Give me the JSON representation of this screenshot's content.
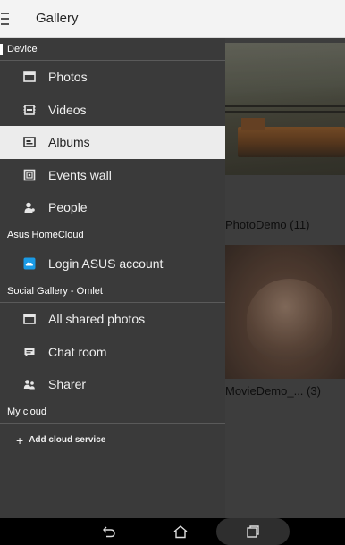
{
  "appbar": {
    "menu_icon": "hamburger-icon",
    "title": "Gallery"
  },
  "drawer": {
    "sections": [
      {
        "header": "Device",
        "items": [
          {
            "label": "Photos",
            "icon": "photos-icon",
            "selected": false
          },
          {
            "label": "Videos",
            "icon": "videos-icon",
            "selected": false
          },
          {
            "label": "Albums",
            "icon": "albums-icon",
            "selected": true
          },
          {
            "label": "Events wall",
            "icon": "events-wall-icon",
            "selected": false
          },
          {
            "label": "People",
            "icon": "people-icon",
            "selected": false
          }
        ]
      },
      {
        "header": "Asus HomeCloud",
        "items": [
          {
            "label": "Login ASUS account",
            "icon": "asus-cloud-icon",
            "selected": false
          }
        ]
      },
      {
        "header": "Social Gallery - Omlet",
        "items": [
          {
            "label": "All shared photos",
            "icon": "shared-photos-icon",
            "selected": false
          },
          {
            "label": "Chat room",
            "icon": "chat-icon",
            "selected": false
          },
          {
            "label": "Sharer",
            "icon": "sharer-icon",
            "selected": false
          }
        ]
      },
      {
        "header": "My cloud",
        "add_label": "Add cloud service"
      }
    ]
  },
  "content": {
    "albums": [
      {
        "caption": "PhotoDemo (11)"
      },
      {
        "caption": "MovieDemo_...  (3)"
      }
    ]
  },
  "navbar": {
    "back_icon": "back-icon",
    "home_icon": "home-icon",
    "recent_icon": "recent-apps-icon"
  },
  "colors": {
    "drawer_bg": "#3a3a3a",
    "selected_bg": "#ececec",
    "appbar_bg": "#f3f3f3",
    "asus_icon": "#1a9be6"
  }
}
